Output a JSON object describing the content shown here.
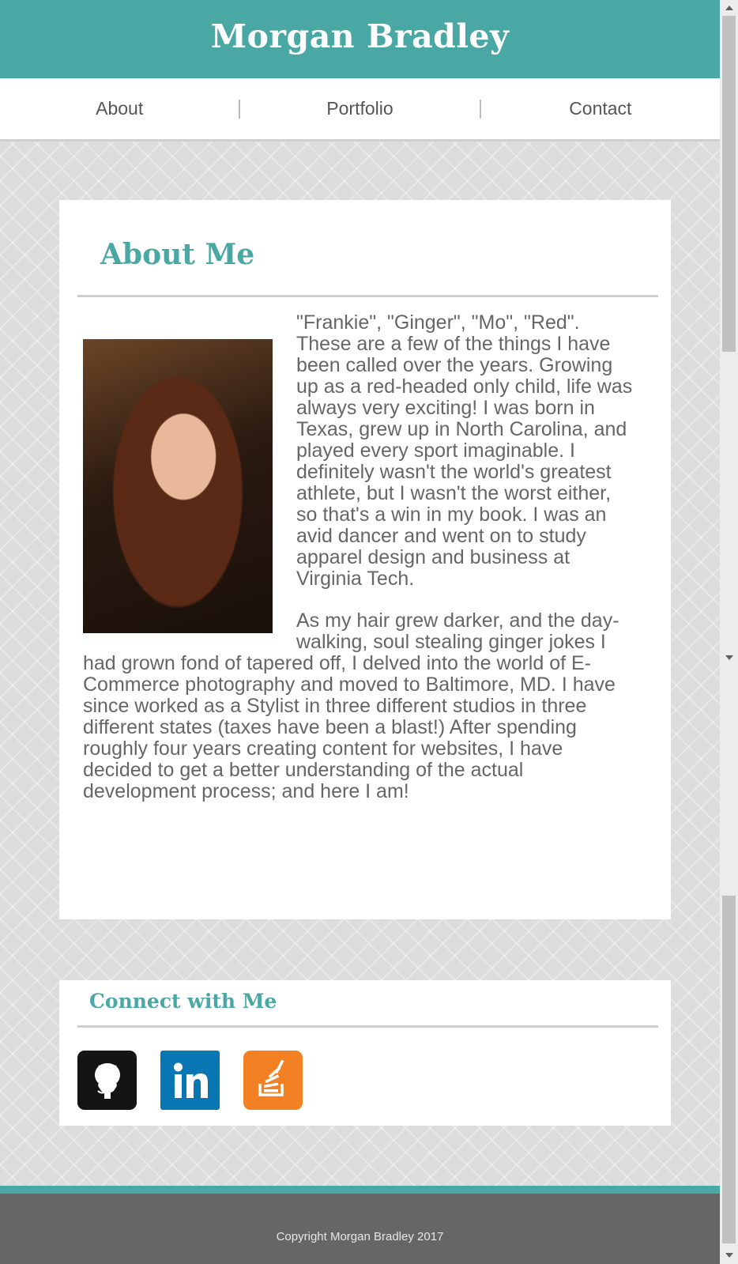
{
  "header": {
    "title": "Morgan Bradley"
  },
  "nav": {
    "items": [
      "About",
      "Portfolio",
      "Contact"
    ]
  },
  "about": {
    "title": "About Me",
    "paragraphs": [
      "\"Frankie\", \"Ginger\", \"Mo\", \"Red\". These are a few of the things I have been called over the years. Growing up as a red-headed only child, life was always very exciting! I was born in Texas, grew up in North Carolina, and played every sport imaginable. I definitely wasn't the world's greatest athlete, but I wasn't the worst either, so that's a win in my book. I was an avid dancer and went on to study apparel design and business at Virginia Tech.",
      "As my hair grew darker, and the day-walking, soul stealing ginger jokes I had grown fond of tapered off, I delved into the world of E-Commerce photography and moved to Baltimore, MD. I have since worked as a Stylist in three different studios in three different states (taxes have been a blast!) After spending roughly four years creating content for websites, I have decided to get a better understanding of the actual development process; and here I am!"
    ]
  },
  "connect": {
    "title": "Connect with Me",
    "links": [
      {
        "icon": "github-icon",
        "color": "#141414"
      },
      {
        "icon": "linkedin-icon",
        "color": "#0a77b5"
      },
      {
        "icon": "stackoverflow-icon",
        "color": "#f48024"
      }
    ]
  },
  "footer": {
    "copyright": "Copyright Morgan Bradley 2017"
  },
  "colors": {
    "accent": "#4aa8a4",
    "footer": "#666666"
  }
}
